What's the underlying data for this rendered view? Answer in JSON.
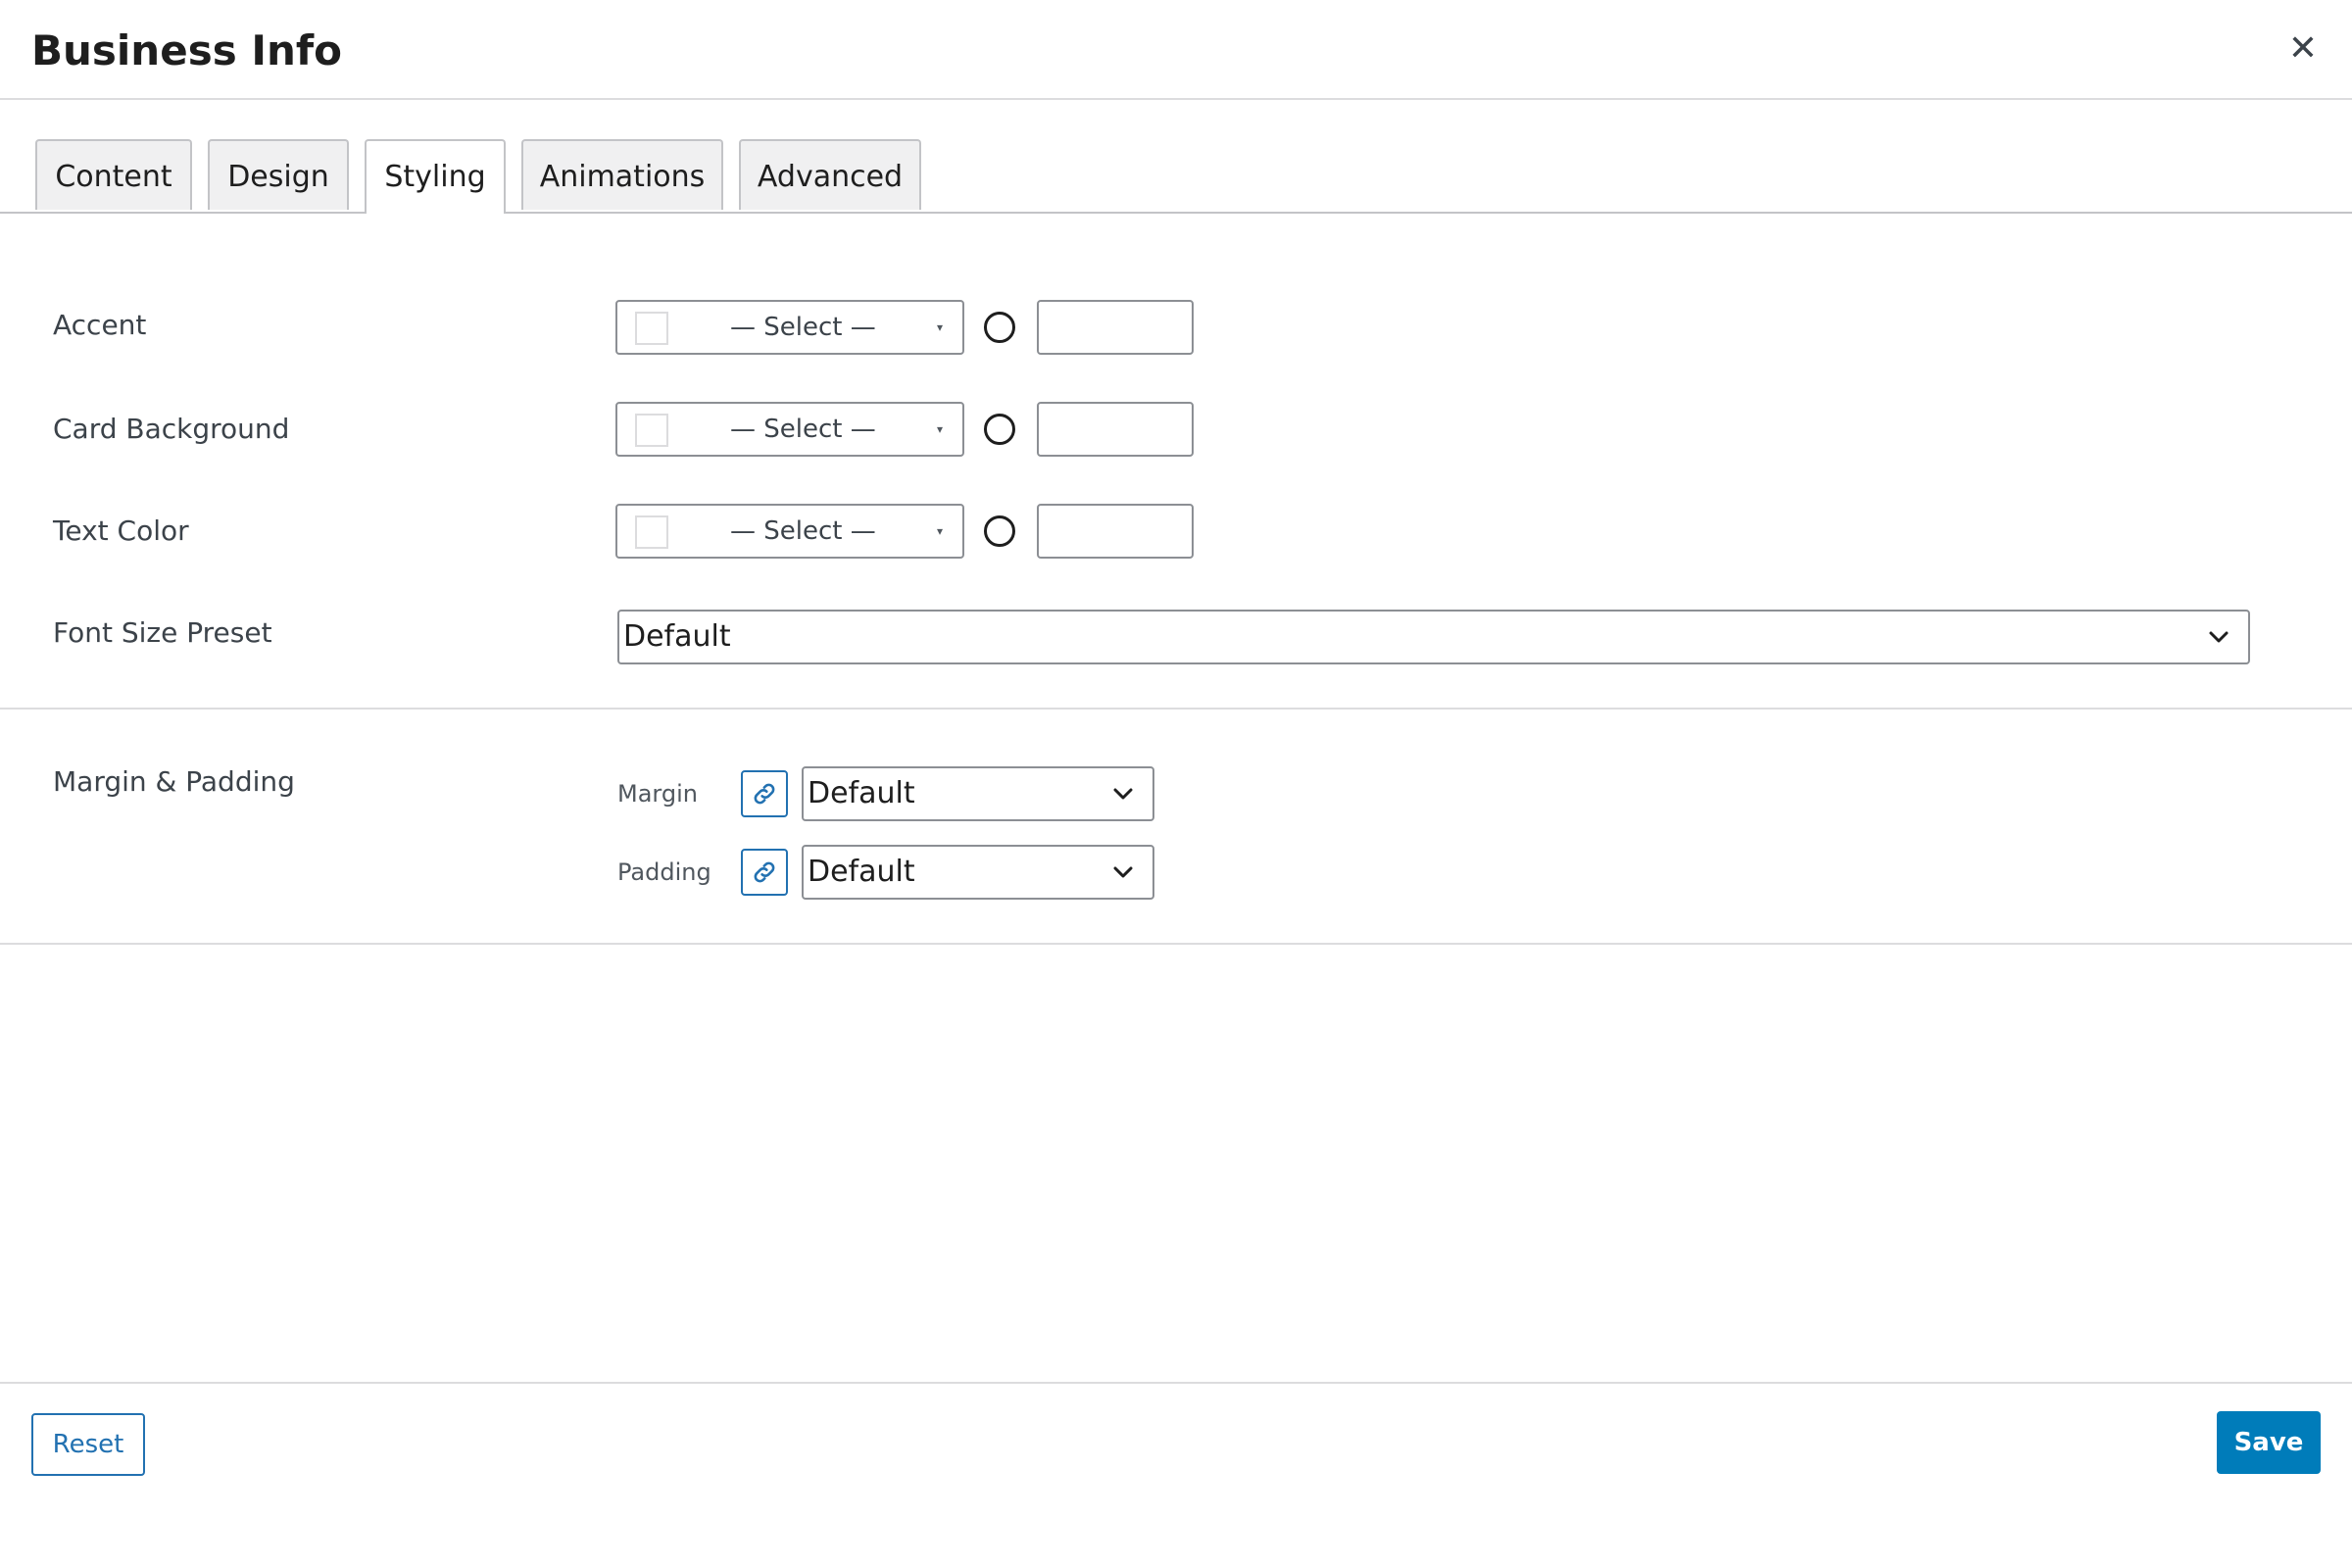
{
  "header": {
    "title": "Business Info",
    "close_symbol": "✕"
  },
  "tabs": [
    {
      "label": "Content",
      "active": false
    },
    {
      "label": "Design",
      "active": false
    },
    {
      "label": "Styling",
      "active": true
    },
    {
      "label": "Animations",
      "active": false
    },
    {
      "label": "Advanced",
      "active": false
    }
  ],
  "styling": {
    "accent": {
      "label": "Accent",
      "select_text": "— Select —",
      "hex_value": ""
    },
    "card_background": {
      "label": "Card Background",
      "select_text": "— Select —",
      "hex_value": ""
    },
    "text_color": {
      "label": "Text Color",
      "select_text": "— Select —",
      "hex_value": ""
    },
    "caret_symbol": "▾",
    "font_size_preset": {
      "label": "Font Size Preset",
      "value": "Default"
    }
  },
  "spacing": {
    "label": "Margin & Padding",
    "margin": {
      "label": "Margin",
      "value": "Default"
    },
    "padding": {
      "label": "Padding",
      "value": "Default"
    }
  },
  "footer": {
    "reset_label": "Reset",
    "save_label": "Save"
  },
  "colors": {
    "accent": "#2271b1",
    "save_bg": "#007cba",
    "border": "#8c8f94"
  }
}
